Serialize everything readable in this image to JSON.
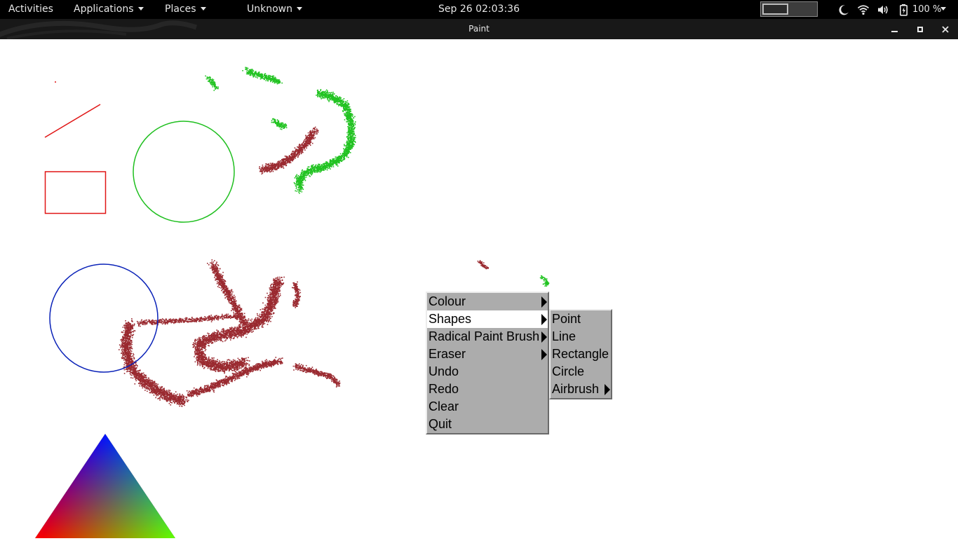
{
  "topbar": {
    "activities": "Activities",
    "applications": "Applications",
    "places": "Places",
    "unknown": "Unknown",
    "clock": "Sep 26  02:03:36",
    "battery_percent": "100 %",
    "icons": [
      "moon-icon",
      "wifi-icon",
      "volume-icon",
      "battery-icon"
    ]
  },
  "window": {
    "title": "Paint"
  },
  "menu": {
    "items": [
      {
        "label": "Colour",
        "submenu": true
      },
      {
        "label": "Shapes",
        "submenu": true,
        "highlighted": true
      },
      {
        "label": "Radical Paint Brush",
        "submenu": true
      },
      {
        "label": "Eraser",
        "submenu": true
      },
      {
        "label": "Undo",
        "submenu": false
      },
      {
        "label": "Redo",
        "submenu": false
      },
      {
        "label": "Clear",
        "submenu": false
      },
      {
        "label": "Quit",
        "submenu": false
      }
    ],
    "shapes_submenu": [
      {
        "label": "Point",
        "submenu": false
      },
      {
        "label": "Line",
        "submenu": false
      },
      {
        "label": "Rectangle",
        "submenu": false
      },
      {
        "label": "Circle",
        "submenu": false
      },
      {
        "label": "Airbrush",
        "submenu": true
      }
    ]
  },
  "colors": {
    "red": "#e01515",
    "green": "#1fbf1f",
    "blue": "#0a22b8",
    "maroon": "#9a2a30",
    "airbrush_green": "#22c322",
    "menu_bg": "#acacac"
  }
}
